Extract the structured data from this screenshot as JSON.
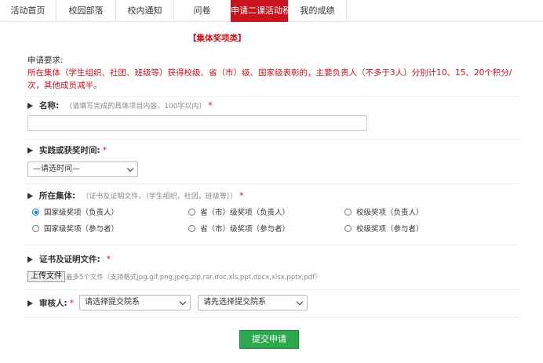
{
  "nav": {
    "tabs": [
      {
        "label": "活动首页"
      },
      {
        "label": "校园部落"
      },
      {
        "label": "校内通知"
      },
      {
        "label": "问卷"
      },
      {
        "label": "申请二课活动积"
      },
      {
        "label": "我的成绩"
      }
    ],
    "active_index": 4
  },
  "section_title": "【集体奖项类】",
  "requirements": {
    "label": "申请要求:",
    "text": "所在集体（学生组织、社团、班级等）获得校级、省（市）级、国家级表彰的，主要负责人（不多于3人）分别计10、15、20个积分/次，其他成员减半。"
  },
  "fields": {
    "name": {
      "label": "名称:",
      "hint": "（请填写完成的具体项目内容，100字以内）",
      "required": "*",
      "value": ""
    },
    "time": {
      "label": "实践或获奖时间:",
      "required": "*",
      "select_value": "—请选时间—"
    },
    "collective": {
      "label": "所在集体:",
      "hint": "（证书及证明文件，（学生组织，社团，班级等））",
      "required": "*",
      "options": [
        {
          "label": "国家级奖项（负责人）",
          "checked": true
        },
        {
          "label": "省（市）级奖项（负责人）",
          "checked": false
        },
        {
          "label": "校级奖项（负责人）",
          "checked": false
        },
        {
          "label": "国家级奖项（参与者）",
          "checked": false
        },
        {
          "label": "省（市）级奖项（参与者）",
          "checked": false
        },
        {
          "label": "校级奖项（参与者）",
          "checked": false
        }
      ]
    },
    "certificate": {
      "label": "证书及证明文件:",
      "required": "*",
      "upload_label": "上传文件",
      "upload_hint": "最多5个文件（支持格式jpg,gif,png,jpeg,zip,rar,doc,xls,ppt,docx,xlsx,pptx,pdf）"
    },
    "reviewer": {
      "label": "审核人:",
      "required": "*",
      "college_select": "请选择提交院系",
      "reviewer_select": "请先选择提交院系"
    }
  },
  "submit_label": "提交申请",
  "colors": {
    "accent_red": "#c8141f",
    "submit_green": "#2ea84e",
    "radio_blue": "#1a73e8"
  }
}
